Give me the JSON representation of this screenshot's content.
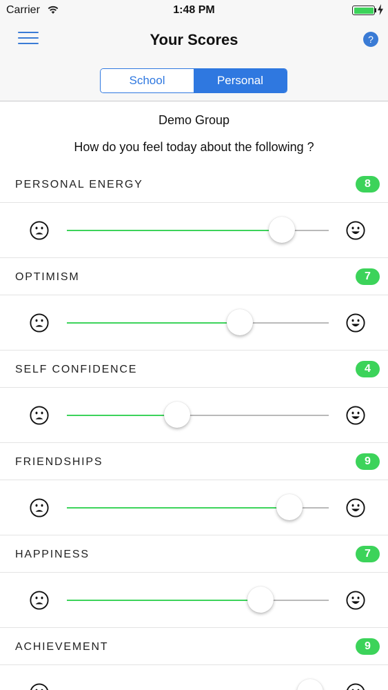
{
  "status_bar": {
    "carrier": "Carrier",
    "time": "1:48 PM",
    "battery_level": 1.0,
    "charging": true
  },
  "nav": {
    "title": "Your Scores",
    "menu_icon": "hamburger-menu-icon",
    "help_icon": "help-question-icon",
    "help_glyph": "?"
  },
  "segments": [
    {
      "label": "School",
      "active": false
    },
    {
      "label": "Personal",
      "active": true
    }
  ],
  "group_name": "Demo Group",
  "prompt": "How do you feel today about the following ?",
  "colors": {
    "accent": "#2f78e0",
    "badge_green": "#3cd35a",
    "track_gray": "#b9b9b9"
  },
  "slider_icons": {
    "min": "sad-face-icon",
    "max": "happy-face-icon"
  },
  "metrics": [
    {
      "label": "PERSONAL ENERGY",
      "score": "8",
      "level": 0.82
    },
    {
      "label": "OPTIMISM",
      "score": "7",
      "level": 0.66
    },
    {
      "label": "SELF CONFIDENCE",
      "score": "4",
      "level": 0.42
    },
    {
      "label": "FRIENDSHIPS",
      "score": "9",
      "level": 0.85
    },
    {
      "label": "HAPPINESS",
      "score": "7",
      "level": 0.74
    },
    {
      "label": "ACHIEVEMENT",
      "score": "9",
      "level": 0.93
    }
  ]
}
